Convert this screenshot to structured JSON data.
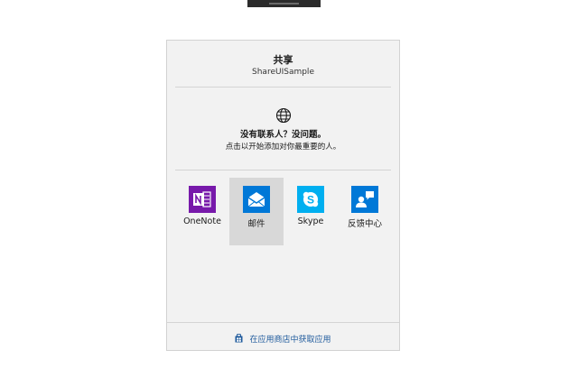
{
  "share": {
    "title": "共享",
    "app_name": "ShareUISample"
  },
  "contacts": {
    "icon": "globe-icon",
    "heading": "没有联系人？没问题。",
    "hint": "点击以开始添加对你最重要的人。"
  },
  "apps": [
    {
      "label": "OneNote",
      "icon": "onenote-icon",
      "color": "#7719aa",
      "selected": false
    },
    {
      "label": "邮件",
      "icon": "mail-icon",
      "color": "#0078d7",
      "selected": true
    },
    {
      "label": "Skype",
      "icon": "skype-icon",
      "color": "#00aff0",
      "selected": false
    },
    {
      "label": "反馈中心",
      "icon": "feedback-hub-icon",
      "color": "#0078d7",
      "selected": false
    }
  ],
  "store": {
    "icon": "store-bag-icon",
    "link_label": "在应用商店中获取应用"
  },
  "colors": {
    "panel_background": "#f2f2f2",
    "selection_highlight": "#d8d8d8",
    "link": "#1f5a9c"
  }
}
